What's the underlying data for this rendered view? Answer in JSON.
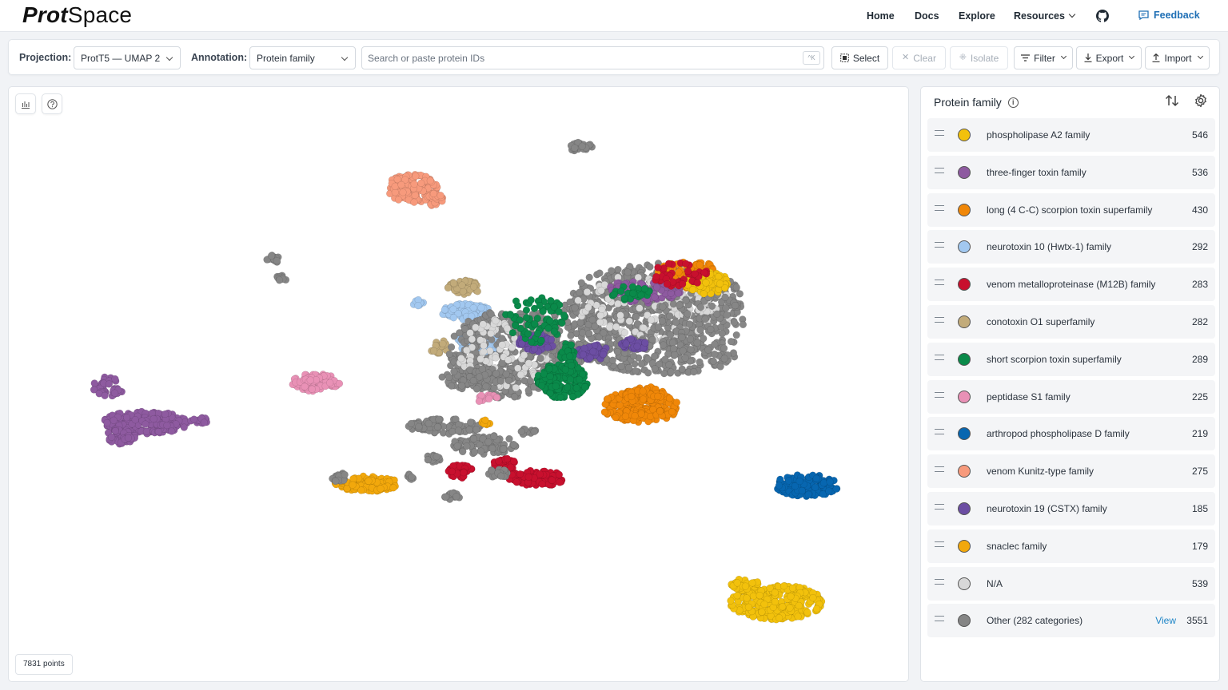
{
  "app": {
    "logo_bold": "Prot",
    "logo_regular": "Space"
  },
  "nav": {
    "home": "Home",
    "docs": "Docs",
    "explore": "Explore",
    "resources": "Resources",
    "feedback": "Feedback"
  },
  "toolbar": {
    "projection_label": "Projection:",
    "projection_value": "ProtT5 — UMAP 2",
    "annotation_label": "Annotation:",
    "annotation_value": "Protein family",
    "search_placeholder": "Search or paste protein IDs",
    "search_shortcut": "^K",
    "select": "Select",
    "clear": "Clear",
    "isolate": "Isolate",
    "filter": "Filter",
    "export": "Export",
    "import": "Import"
  },
  "plot": {
    "points_label": "7831 points"
  },
  "legend": {
    "title": "Protein family",
    "view_label": "View",
    "items": [
      {
        "label": "phospholipase A2 family",
        "count": "546",
        "color": "#f2c10c"
      },
      {
        "label": "three-finger toxin family",
        "count": "536",
        "color": "#8e5aa0"
      },
      {
        "label": "long (4 C-C) scorpion toxin superfamily",
        "count": "430",
        "color": "#f08708"
      },
      {
        "label": "neurotoxin 10 (Hwtx-1) family",
        "count": "292",
        "color": "#a2c8f0"
      },
      {
        "label": "venom metalloproteinase (M12B) family",
        "count": "283",
        "color": "#c8102e"
      },
      {
        "label": "conotoxin O1 superfamily",
        "count": "282",
        "color": "#c2ab7a"
      },
      {
        "label": "short scorpion toxin superfamily",
        "count": "289",
        "color": "#0a8a4a"
      },
      {
        "label": "peptidase S1 family",
        "count": "225",
        "color": "#e991b6"
      },
      {
        "label": "arthropod phospholipase D family",
        "count": "219",
        "color": "#0766b0"
      },
      {
        "label": "venom Kunitz-type family",
        "count": "275",
        "color": "#f79a7c"
      },
      {
        "label": "neurotoxin 19 (CSTX) family",
        "count": "185",
        "color": "#6c4ea3"
      },
      {
        "label": "snaclec family",
        "count": "179",
        "color": "#f2a80c"
      },
      {
        "label": "N/A",
        "count": "539",
        "color": "#d8d8d8"
      },
      {
        "label": "Other (282 categories)",
        "count": "3551",
        "color": "#858585"
      }
    ]
  }
}
